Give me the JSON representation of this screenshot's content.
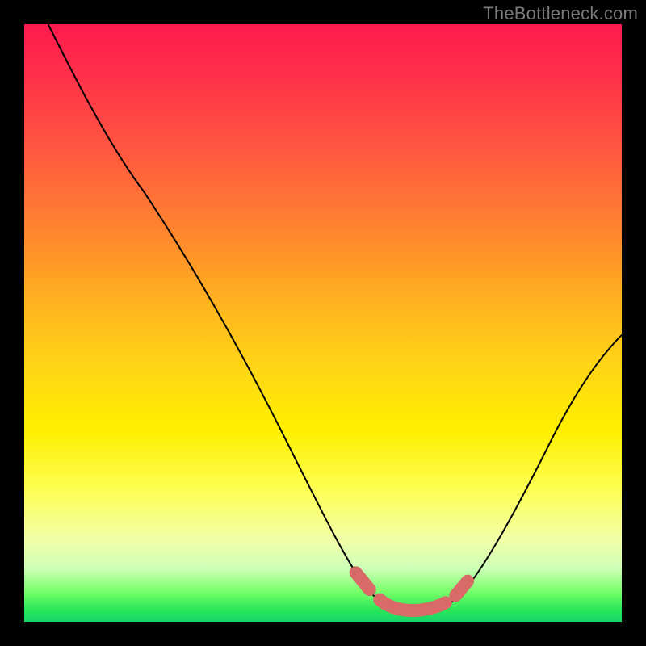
{
  "watermark": "TheBottleneck.com",
  "chart_data": {
    "type": "line",
    "title": "",
    "xlabel": "",
    "ylabel": "",
    "xlim": [
      0,
      100
    ],
    "ylim": [
      0,
      100
    ],
    "grid": false,
    "legend": false,
    "series": [
      {
        "name": "curve",
        "x": [
          4,
          10,
          20,
          30,
          40,
          50,
          56,
          60,
          64,
          68,
          72,
          80,
          90,
          100
        ],
        "y": [
          100,
          89,
          72,
          54,
          36,
          18,
          7,
          3,
          2,
          2,
          3,
          12,
          30,
          48
        ]
      }
    ],
    "highlight_band": {
      "name": "optimal-range",
      "x": [
        56,
        72
      ],
      "y": [
        7,
        2,
        2,
        3
      ]
    }
  }
}
